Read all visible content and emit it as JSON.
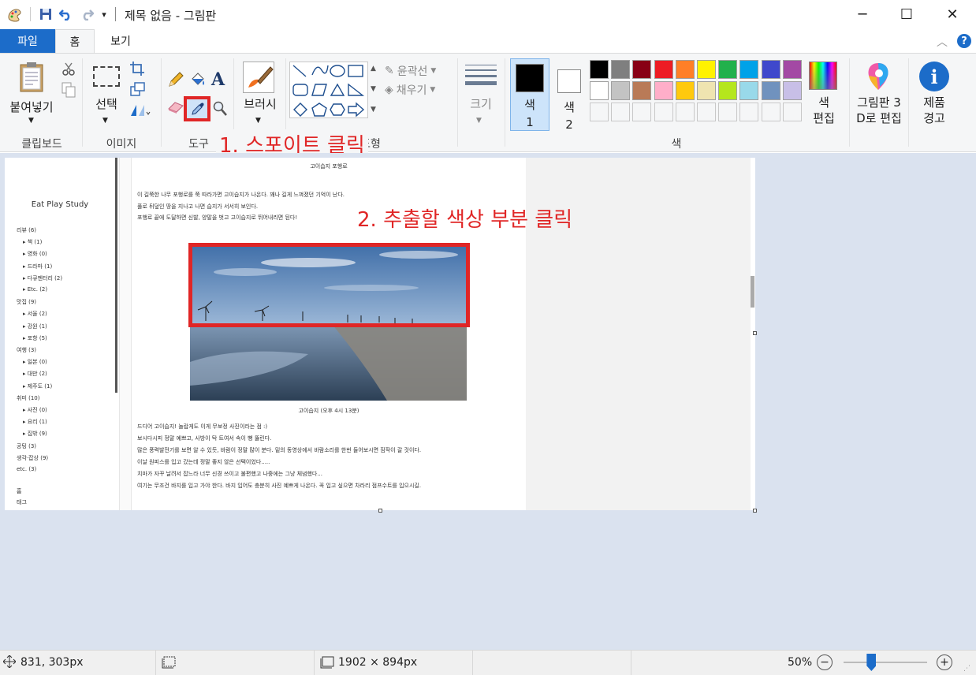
{
  "window": {
    "title": "제목 없음 - 그림판",
    "minimize": "─",
    "maximize": "☐",
    "close": "✕"
  },
  "quick_access": {
    "dropdown": "▾"
  },
  "tabs": {
    "file": "파일",
    "home": "홈",
    "view": "보기"
  },
  "ribbon": {
    "clipboard": {
      "paste": "붙여넣기",
      "group": "클립보드"
    },
    "image": {
      "select": "선택",
      "group": "이미지"
    },
    "tools": {
      "group": "도구"
    },
    "brushes": {
      "label": "브러시"
    },
    "shapes": {
      "outline": "윤곽선",
      "fill": "채우기",
      "group": "도형"
    },
    "size": {
      "label": "크기"
    },
    "colors": {
      "color1": "색\n1",
      "color1_a": "색",
      "color1_b": "1",
      "color2_a": "색",
      "color2_b": "2",
      "edit_a": "색",
      "edit_b": "편집",
      "group": "색",
      "palette_row1": [
        "#000000",
        "#7f7f7f",
        "#880015",
        "#ed1c24",
        "#ff7f27",
        "#fff200",
        "#22b14c",
        "#00a2e8",
        "#3f48cc",
        "#a349a4"
      ],
      "palette_row2": [
        "#ffffff",
        "#c3c3c3",
        "#b97a57",
        "#ffaec9",
        "#ffc90e",
        "#efe4b0",
        "#b5e61d",
        "#99d9ea",
        "#7092be",
        "#c8bfe7"
      ]
    },
    "paint3d": {
      "line1": "그림판 3",
      "line2": "D로 편집"
    },
    "alert": {
      "line1": "제품",
      "line2": "경고"
    }
  },
  "annotations": {
    "step1": "1. 스포이트 클릭",
    "step2": "2. 추출할 색상 부분 클릭"
  },
  "canvas": {
    "sidebar": {
      "blog_title": "Eat Play Study",
      "items": [
        "리뷰 (6)",
        "▸ 책 (1)",
        "▸ 영화 (0)",
        "▸ 드라마 (1)",
        "▸ 다큐멘터리 (2)",
        "▸ Etc. (2)",
        "맛집 (9)",
        "▸ 서울 (2)",
        "▸ 강원 (1)",
        "▸ 포항 (5)",
        "여행 (3)",
        "▸ 일본 (0)",
        "▸ 대만 (2)",
        "▸ 제주도 (1)",
        "취미 (10)",
        "▸ 사진 (0)",
        "▸ 요리 (1)",
        "▸ 집밖 (9)",
        "공팅 (3)",
        "생각·잡상 (9)",
        "etc. (3)"
      ],
      "footer1": "홈",
      "footer2": "태그"
    },
    "post": {
      "heading": "고이습지 포행로",
      "para1": [
        "이 길쭉한 나무 포행로를 쭉 따라가면 고이습지가 나온다. 꽤나 길게 느껴졌던 기억이 난다.",
        "풀로 뒤덮인 땅을 지나고 나면 습지가 서서히 보인다.",
        "포행로 끝에 도달하면 신발, 양말을 벗고 고이습지로 뛰어내리면 된다!"
      ],
      "caption": "고이습지 (오후 4시 13분)",
      "para2": [
        "드디어 고이습지! 놀랍게도 이게 무보정 사진이라는 점 :)",
        "보시다시피 정말 예쁘고, 사방이 탁 트여서 속이 뻥 뚫린다.",
        "많은 풍력발전기를 보면 알 수 있듯, 바람이 정말 많이 분다. 밑의 동영상에서 바람소리를 한번 들어보시면 짐작이 갈 것이다.",
        "이날 원피스를 입고 갔는데 정말 좋지 않은 선택이었다.....",
        "치마가 자꾸 날려서 잡느라 너무 신경 쓰이고 불편했고 나중에는 그냥 체념했다...",
        "여기는 무조건 바지를 입고 가야 한다. 바지 입어도 충분히 사진 예쁘게 나온다. 꼭 입고 싶으면 차라리 점프수트를 입으시길."
      ]
    }
  },
  "status": {
    "cursor_pos": "831, 303px",
    "image_size": "1902 × 894px",
    "zoom": "50%",
    "zoom_level": 0.5
  }
}
